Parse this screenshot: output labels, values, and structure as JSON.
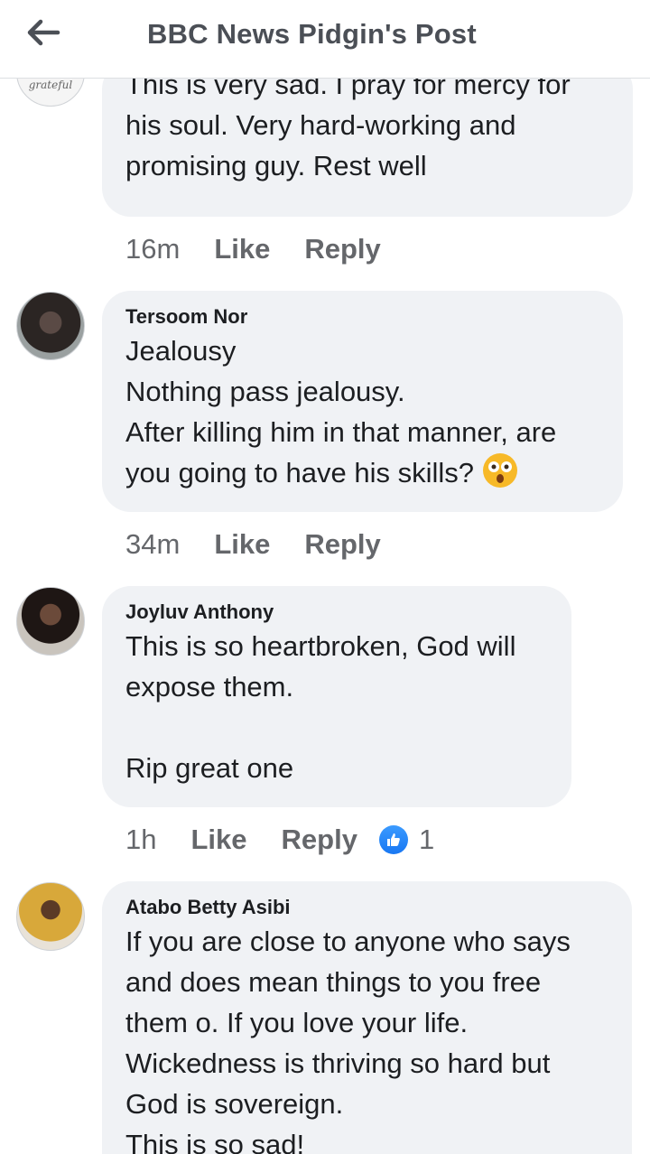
{
  "header": {
    "title": "BBC News Pidgin's Post",
    "back_icon": "arrow-left-icon"
  },
  "comments": [
    {
      "author": "",
      "avatar_text": "grateful",
      "text": "This is very sad. I pray for mercy for his soul. Very hard-working and promising guy. Rest well",
      "time": "16m",
      "like": "Like",
      "reply": "Reply"
    },
    {
      "author": "Tersoom Nor",
      "text": "Jealousy\nNothing pass jealousy.\nAfter killing him in that manner, are you going to have his skills?",
      "emoji": "astonished-face-emoji",
      "time": "34m",
      "like": "Like",
      "reply": "Reply"
    },
    {
      "author": "Joyluv Anthony",
      "text": "This is so heartbroken, God will expose them.\n\nRip great one",
      "time": "1h",
      "like": "Like",
      "reply": "Reply",
      "reaction_count": "1",
      "reaction_icon": "thumbs-up-icon",
      "reaction_color": "#1877f2"
    },
    {
      "author": "Atabo Betty Asibi",
      "text": "If you are close to anyone who says and does mean things to you free them o. If you love your life. Wickedness is thriving so hard but God is sovereign.\nThis is so sad!"
    }
  ]
}
